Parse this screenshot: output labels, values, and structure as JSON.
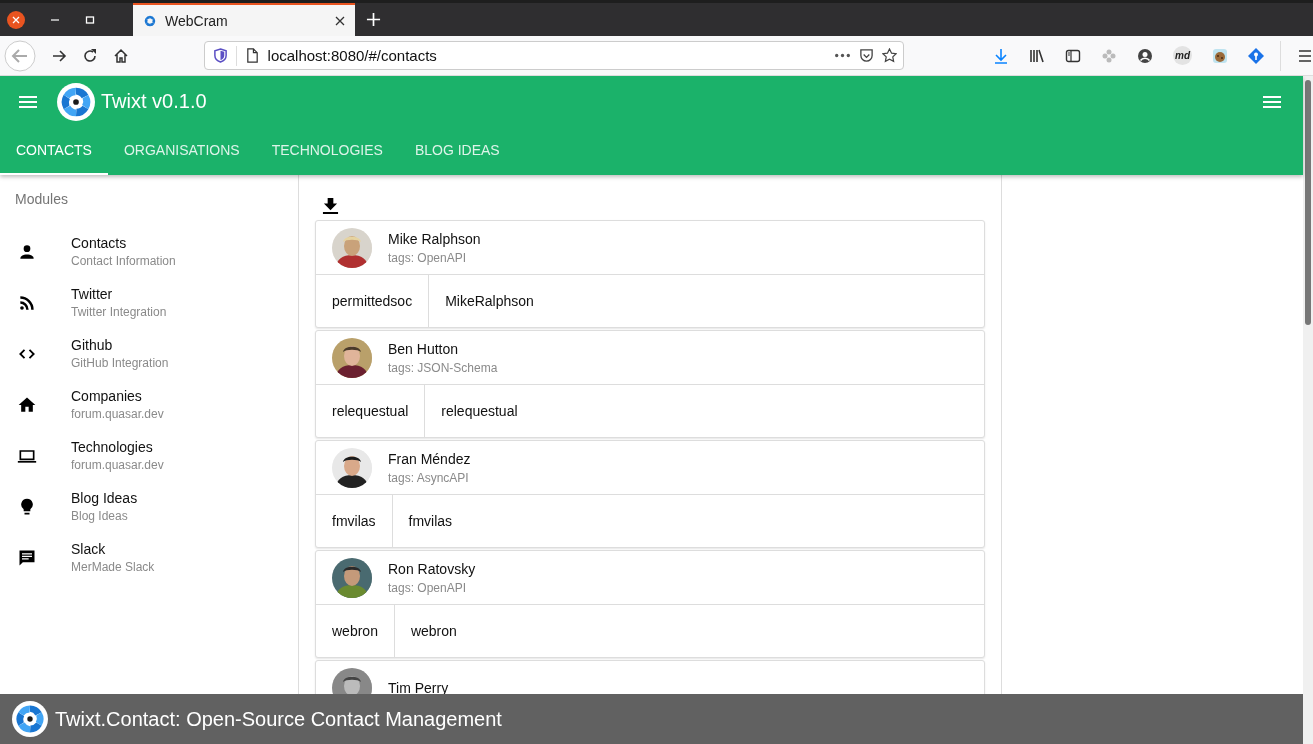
{
  "browser": {
    "tabs": [
      {
        "title": "WebCram",
        "selected": true
      }
    ],
    "url": "localhost:8080/#/contacts",
    "extension_badge": "md"
  },
  "app": {
    "title": "Twixt v0.1.0",
    "tabs": [
      {
        "label": "CONTACTS",
        "selected": true
      },
      {
        "label": "ORGANISATIONS",
        "selected": false
      },
      {
        "label": "TECHNOLOGIES",
        "selected": false
      },
      {
        "label": "BLOG IDEAS",
        "selected": false
      }
    ]
  },
  "sidebar": {
    "heading": "Modules",
    "items": [
      {
        "kind": "person",
        "title": "Contacts",
        "subtitle": "Contact Information"
      },
      {
        "kind": "rss",
        "title": "Twitter",
        "subtitle": "Twitter Integration"
      },
      {
        "kind": "code",
        "title": "Github",
        "subtitle": "GitHub Integration"
      },
      {
        "kind": "home",
        "title": "Companies",
        "subtitle": "forum.quasar.dev"
      },
      {
        "kind": "laptop",
        "title": "Technologies",
        "subtitle": "forum.quasar.dev"
      },
      {
        "kind": "bulb",
        "title": "Blog Ideas",
        "subtitle": "Blog Ideas"
      },
      {
        "kind": "chat",
        "title": "Slack",
        "subtitle": "MerMade Slack"
      }
    ]
  },
  "contacts": [
    {
      "name": "Mike Ralphson",
      "tags": "tags: OpenAPI",
      "handles": [
        "permittedsoc",
        "MikeRalphson"
      ]
    },
    {
      "name": "Ben Hutton",
      "tags": "tags: JSON-Schema",
      "handles": [
        "relequestual",
        "relequestual"
      ]
    },
    {
      "name": "Fran Méndez",
      "tags": "tags: AsyncAPI",
      "handles": [
        "fmvilas",
        "fmvilas"
      ]
    },
    {
      "name": "Ron Ratovsky",
      "tags": "tags: OpenAPI",
      "handles": [
        "webron",
        "webron"
      ]
    },
    {
      "name": "Tim Perry"
    }
  ],
  "footer": {
    "text": "Twixt.Contact: Open-Source Contact Management"
  }
}
